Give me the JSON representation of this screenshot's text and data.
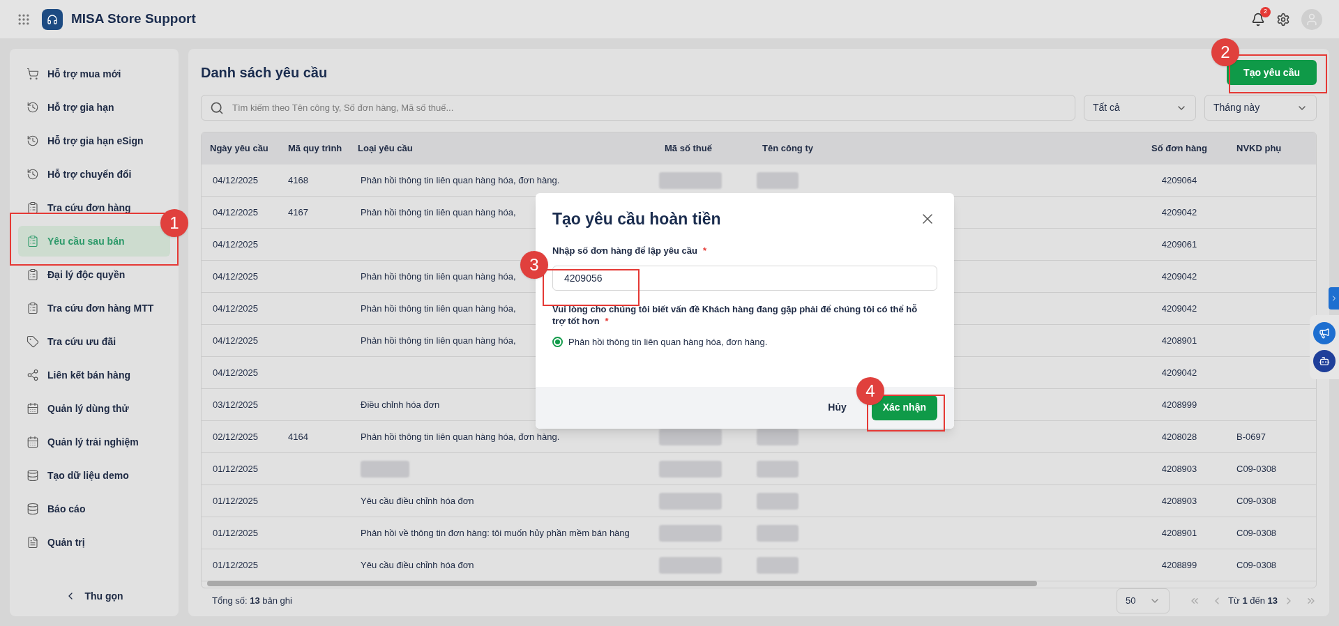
{
  "app": {
    "title": "MISA Store Support",
    "notification_count": "2"
  },
  "sidebar": {
    "items": [
      {
        "label": "Hỗ trợ mua mới",
        "selected": false
      },
      {
        "label": "Hỗ trợ gia hạn",
        "selected": false
      },
      {
        "label": "Hỗ trợ gia hạn eSign",
        "selected": false
      },
      {
        "label": "Hỗ trợ chuyển đổi",
        "selected": false
      },
      {
        "label": "Tra cứu đơn hàng",
        "selected": false
      },
      {
        "label": "Yêu cầu sau bán",
        "selected": true
      },
      {
        "label": "Đại lý độc quyền",
        "selected": false
      },
      {
        "label": "Tra cứu đơn hàng MTT",
        "selected": false
      },
      {
        "label": "Tra cứu ưu đãi",
        "selected": false
      },
      {
        "label": "Liên kết bán hàng",
        "selected": false
      },
      {
        "label": "Quản lý dùng thử",
        "selected": false
      },
      {
        "label": "Quản lý trải nghiệm",
        "selected": false
      },
      {
        "label": "Tạo dữ liệu demo",
        "selected": false
      },
      {
        "label": "Báo cáo",
        "selected": false
      },
      {
        "label": "Quản trị",
        "selected": false
      }
    ],
    "collapse": "Thu gọn"
  },
  "page": {
    "title": "Danh sách yêu cầu",
    "create_button": "Tạo yêu cầu",
    "search": {
      "placeholder": "Tìm kiếm theo Tên công ty, Số đơn hàng, Mã số thuế..."
    },
    "filters": [
      {
        "value": "Tất cả"
      },
      {
        "value": "Tháng này"
      }
    ]
  },
  "table": {
    "columns": [
      "Ngày yêu cầu",
      "Mã quy trình",
      "Loại yêu cầu",
      "Mã số thuế",
      "Tên công ty",
      "Số đơn hàng",
      "NVKD phụ"
    ],
    "rows": [
      {
        "date": "04/12/2025",
        "process": "4168",
        "type": "Phản hồi thông tin liên quan hàng hóa, đơn hàng.",
        "masked": true,
        "type_masked": false,
        "order": "4209064"
      },
      {
        "date": "04/12/2025",
        "process": "4167",
        "type": "Phản hồi thông tin liên quan hàng hóa,",
        "type_masked": false,
        "order": "4209042"
      },
      {
        "date": "04/12/2025",
        "type_masked": false,
        "order": "4209061"
      },
      {
        "date": "04/12/2025",
        "type": "Phản hồi thông tin liên quan hàng hóa,",
        "type_masked": false,
        "order": "4209042"
      },
      {
        "date": "04/12/2025",
        "type": "Phản hồi thông tin liên quan hàng hóa,",
        "type_masked": false,
        "order": "4209042"
      },
      {
        "date": "04/12/2025",
        "type": "Phản hồi thông tin liên quan hàng hóa,",
        "type_masked": false,
        "order": "4208901"
      },
      {
        "date": "04/12/2025",
        "type_masked": false,
        "order": "4209042"
      },
      {
        "date": "03/12/2025",
        "type": "Điều chỉnh hóa đơn",
        "type_masked": false,
        "order": "4208999"
      },
      {
        "date": "02/12/2025",
        "process": "4164",
        "type": "Phản hồi thông tin liên quan hàng hóa, đơn hàng.",
        "masked": true,
        "type_masked": false,
        "order": "4208028",
        "rep": "B-0697"
      },
      {
        "date": "01/12/2025",
        "masked": true,
        "type_masked": true,
        "order": "4208903",
        "rep": "C09-0308"
      },
      {
        "date": "01/12/2025",
        "type": "Yêu cầu điều chỉnh hóa đơn",
        "masked": true,
        "type_masked": false,
        "order": "4208903",
        "rep": "C09-0308"
      },
      {
        "date": "01/12/2025",
        "type": "Phản hồi về thông tin đơn hàng: tôi muốn hủy phần mềm bán hàng",
        "masked": true,
        "type_masked": false,
        "order": "4208901",
        "rep": "C09-0308"
      },
      {
        "date": "01/12/2025",
        "type": "Yêu cầu điều chỉnh hóa đơn",
        "masked": true,
        "type_masked": false,
        "order": "4208899",
        "rep": "C09-0308"
      }
    ]
  },
  "footer": {
    "total": "Tổng số: **13** bản ghi",
    "page_size": "50",
    "range": "Từ **1** đến **13**"
  },
  "dialog": {
    "title": "Tạo yêu cầu hoàn tiền",
    "order_field": {
      "label": "Nhập số đơn hàng để lập yêu cầu",
      "required_mark": "*",
      "value": "4209056"
    },
    "question": {
      "label": "Vui lòng cho chúng tôi biết vấn đề Khách hàng đang gặp phải để chúng tôi có thể hỗ trợ tốt hơn",
      "required_mark": "*"
    },
    "options": [
      {
        "label": "Phản hồi thông tin liên quan hàng hóa, đơn hàng.",
        "selected": true
      }
    ],
    "cancel": "Hủy",
    "confirm": "Xác nhận"
  },
  "callouts": [
    {
      "label": "1"
    },
    {
      "label": "2"
    },
    {
      "label": "3"
    },
    {
      "label": "4"
    }
  ]
}
